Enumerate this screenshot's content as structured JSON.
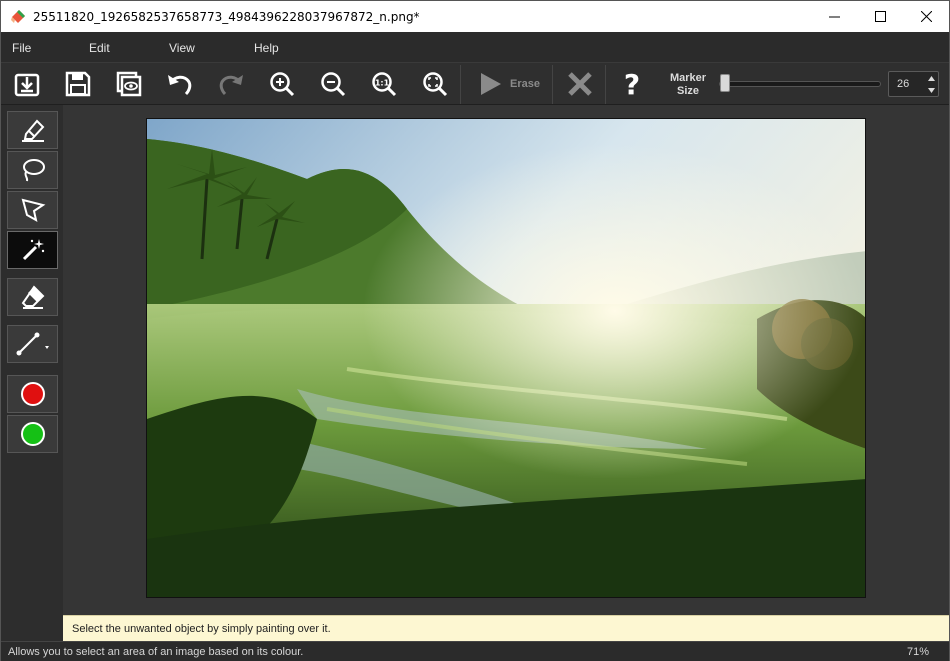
{
  "window": {
    "title": "25511820_1926582537658773_4984396228037967872_n.png*"
  },
  "menu": [
    "File",
    "Edit",
    "View",
    "Help"
  ],
  "toolbar": {
    "erase_label": "Erase",
    "marker_label_line1": "Marker",
    "marker_label_line2": "Size",
    "marker_size": "26"
  },
  "tools": {
    "colors": {
      "remove": "#e01010",
      "keep": "#15c015"
    }
  },
  "hint": "Select the unwanted object by simply painting over it.",
  "status": {
    "message": "Allows you to select an area of an image based on its colour.",
    "zoom": "71%"
  }
}
